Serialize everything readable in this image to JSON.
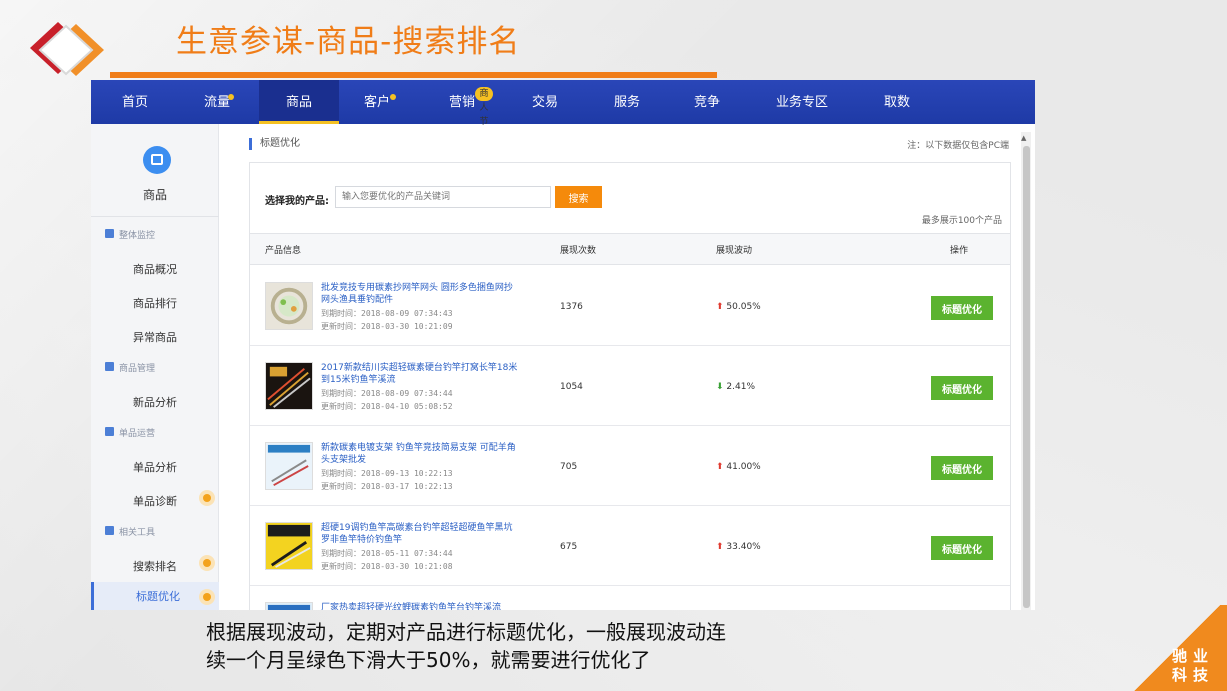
{
  "slide": {
    "title": "生意参谋-商品-搜索排名",
    "caption_line1": "根据展现波动，定期对产品进行标题优化，一般展现波动连",
    "caption_line2": "续一个月呈绿色下滑大于50%，就需要进行优化了",
    "corner_line1": "驰业",
    "corner_line2": "科技",
    "accent_color": "#f07d18"
  },
  "nav": {
    "items": [
      {
        "label": "首页"
      },
      {
        "label": "流量"
      },
      {
        "label": "商品"
      },
      {
        "label": "客户"
      },
      {
        "label": "营销"
      },
      {
        "label": "交易"
      },
      {
        "label": "服务"
      },
      {
        "label": "竞争"
      },
      {
        "label": "业务专区"
      },
      {
        "label": "取数"
      }
    ],
    "badge": "商人节",
    "active": "商品",
    "color": "#2a46b8"
  },
  "sidebar": {
    "title": "商品",
    "icon": "shopping-bag-icon",
    "sections": [
      {
        "label": "整体监控",
        "links": [
          "商品概况",
          "商品排行",
          "异常商品"
        ]
      },
      {
        "label": "商品管理",
        "links": [
          "新品分析"
        ]
      },
      {
        "label": "单品运营",
        "links": [
          "单品分析",
          "单品诊断"
        ]
      },
      {
        "label": "相关工具",
        "links": [
          "搜索排名",
          "标题优化"
        ]
      }
    ],
    "active": "标题优化"
  },
  "content": {
    "crumb": "标题优化",
    "note": "注：以下数据仅包含PC端",
    "choose_label": "选择我的产品:",
    "search_placeholder": "输入您要优化的产品关键词",
    "search_button": "搜索",
    "max_note": "最多展示100个产品",
    "headers": {
      "info": "产品信息",
      "views": "展现次数",
      "trend": "展现波动",
      "action": "操作"
    },
    "rows": [
      {
        "name": "批发竞技专用碳素抄网竿网头 圆形多色捆鱼网抄网头渔具垂钓配件",
        "expire": "到期时间：2018-08-09 07:34:43",
        "update": "更新时间：2018-03-30 10:21:09",
        "views": "1376",
        "trend": "50.05%",
        "direction": "up",
        "action": "标题优化"
      },
      {
        "name": "2017新款结川实超轻碳素硬台钓竿打窝长竿18米到15米钓鱼竿溪流",
        "expire": "到期时间：2018-08-09 07:34:44",
        "update": "更新时间：2018-04-10 05:08:52",
        "views": "1054",
        "trend": "2.41%",
        "direction": "down",
        "action": "标题优化"
      },
      {
        "name": "新款碳素电镀支架 钓鱼竿竞技简易支架 可配羊角头支架批发",
        "expire": "到期时间：2018-09-13 10:22:13",
        "update": "更新时间：2018-03-17 10:22:13",
        "views": "705",
        "trend": "41.00%",
        "direction": "up",
        "action": "标题优化"
      },
      {
        "name": "超硬19调钓鱼竿高碳素台钓竿超轻超硬鱼竿黑坑罗非鱼竿特价钓鱼竿",
        "expire": "到期时间：2018-05-11 07:34:44",
        "update": "更新时间：2018-03-30 10:21:08",
        "views": "675",
        "trend": "33.40%",
        "direction": "up",
        "action": "标题优化"
      },
      {
        "name": "厂家热卖超轻硬光纹鲤碳素钓鱼竿台钓竿溪流",
        "expire": "",
        "update": "",
        "views": "",
        "trend": "",
        "direction": "",
        "action": ""
      }
    ],
    "button_color": "#5bb32f",
    "up_color": "#e03c31",
    "down_color": "#3aa035"
  }
}
